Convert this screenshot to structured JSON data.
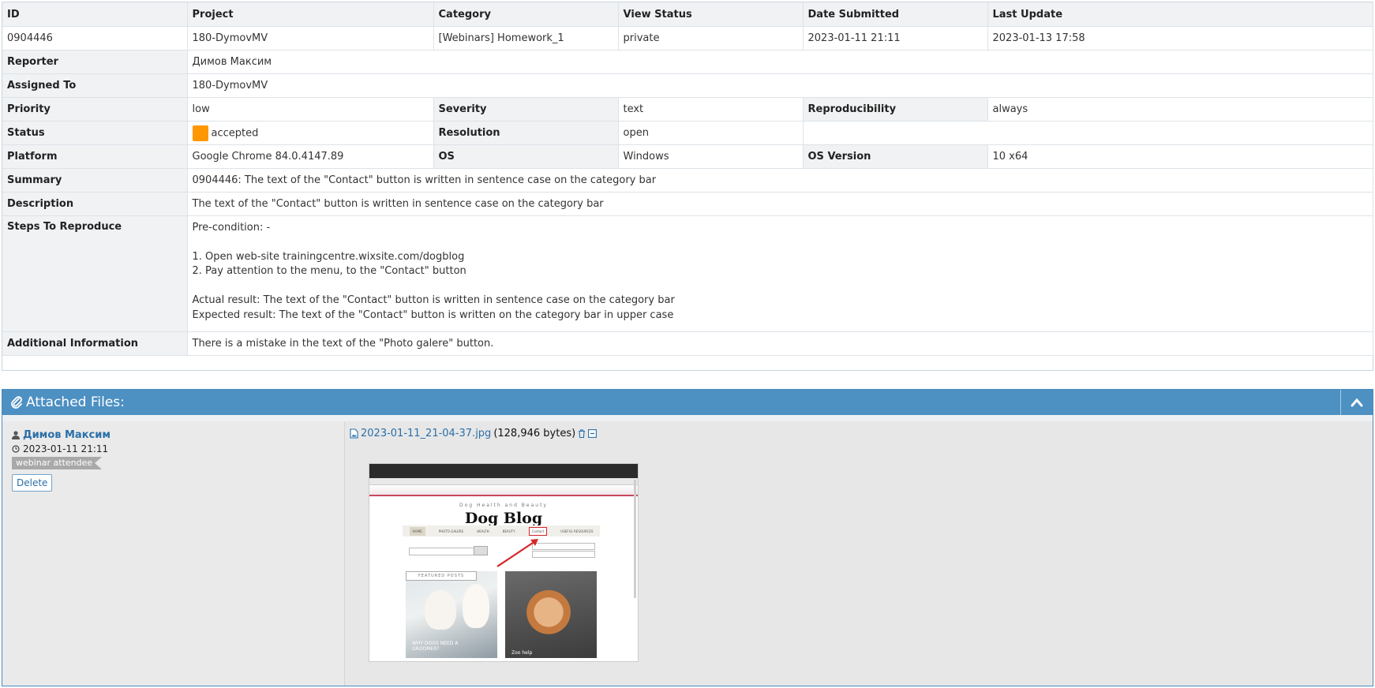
{
  "header": {
    "id_label": "ID",
    "project_label": "Project",
    "category_label": "Category",
    "view_status_label": "View Status",
    "date_submitted_label": "Date Submitted",
    "last_update_label": "Last Update"
  },
  "issue": {
    "id": "0904446",
    "project": "180-DymovMV",
    "category": "[Webinars] Homework_1",
    "view_status": "private",
    "date_submitted": "2023-01-11 21:11",
    "last_update": "2023-01-13 17:58",
    "reporter_label": "Reporter",
    "reporter": "Димов Максим",
    "assigned_label": "Assigned To",
    "assigned": "180-DymovMV",
    "priority_label": "Priority",
    "priority": "low",
    "severity_label": "Severity",
    "severity": "text",
    "reproducibility_label": "Reproducibility",
    "reproducibility": "always",
    "status_label": "Status",
    "status": "accepted",
    "status_color": "#ff9800",
    "resolution_label": "Resolution",
    "resolution": "open",
    "platform_label": "Platform",
    "platform": "Google Chrome 84.0.4147.89",
    "os_label": "OS",
    "os": "Windows",
    "os_version_label": "OS Version",
    "os_version": "10 x64",
    "summary_label": "Summary",
    "summary": "0904446: The text of the \"Contact\" button is written in sentence case on the category bar",
    "description_label": "Description",
    "description": "The text of the \"Contact\" button is written in sentence case on the category bar",
    "steps_label": "Steps To Reproduce",
    "steps": {
      "precondition": "Pre-condition: -",
      "step1": "1. Open web-site trainingcentre.wixsite.com/dogblog",
      "step2": "2. Pay attention to the menu, to the \"Contact\" button",
      "actual": "Actual result: The text of the \"Contact\" button is written in sentence case on the category bar",
      "expected": "Expected result: The text of the \"Contact\" button is written on the category bar in upper case"
    },
    "additional_label": "Additional Information",
    "additional": "There is a mistake in the text of the \"Photo galere\" button."
  },
  "attachments": {
    "title": "Attached Files:",
    "icons": [
      "paperclip-icon",
      "chevron-up-icon",
      "user-icon",
      "clock-icon",
      "image-file-icon",
      "trash-icon",
      "collapse-icon"
    ],
    "uploader_name": "Димов Максим",
    "uploader_date": "2023-01-11 21:11",
    "uploader_tag": "webinar attendee",
    "delete_label": "Delete",
    "file_name": "2023-01-11_21-04-37.jpg",
    "file_size": "(128,946 bytes)",
    "preview": {
      "kicker": "Dog Health and Beauty",
      "blog_title": "Dog Blog",
      "menu": [
        "HOME",
        "PHOTO GALERE",
        "HEALTH",
        "BEAUTY",
        "Contact",
        "USEFUL RESOURCES"
      ],
      "featured": "FEATURED POSTS",
      "post1": "WHY DOGS NEED A GROOMER?",
      "post2": "Zoo help"
    }
  }
}
